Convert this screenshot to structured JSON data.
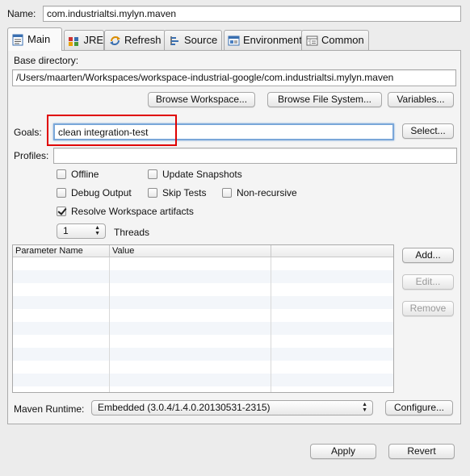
{
  "name": {
    "label": "Name:",
    "value": "com.industrialtsi.mylyn.maven"
  },
  "tabs": [
    {
      "label": "Main",
      "icon": "document-icon",
      "active": true
    },
    {
      "label": "JRE",
      "icon": "jre-icon",
      "active": false
    },
    {
      "label": "Refresh",
      "icon": "refresh-icon",
      "active": false
    },
    {
      "label": "Source",
      "icon": "source-icon",
      "active": false
    },
    {
      "label": "Environment",
      "icon": "environment-icon",
      "active": false
    },
    {
      "label": "Common",
      "icon": "common-icon",
      "active": false
    }
  ],
  "base_directory": {
    "label": "Base directory:",
    "value": "/Users/maarten/Workspaces/workspace-industrial-google/com.industrialtsi.mylyn.maven",
    "browse_workspace": "Browse Workspace...",
    "browse_file_system": "Browse File System...",
    "variables": "Variables..."
  },
  "goals": {
    "label": "Goals:",
    "value": "clean integration-test",
    "select_button": "Select..."
  },
  "profiles": {
    "label": "Profiles:",
    "value": ""
  },
  "options": {
    "offline": {
      "label": "Offline",
      "checked": false
    },
    "update_snapshots": {
      "label": "Update Snapshots",
      "checked": false
    },
    "debug_output": {
      "label": "Debug Output",
      "checked": false
    },
    "skip_tests": {
      "label": "Skip Tests",
      "checked": false
    },
    "non_recursive": {
      "label": "Non-recursive",
      "checked": false
    },
    "resolve_workspace": {
      "label": "Resolve Workspace artifacts",
      "checked": true
    }
  },
  "threads": {
    "value": "1",
    "label": "Threads"
  },
  "parameters": {
    "columns": [
      "Parameter Name",
      "Value"
    ],
    "rows": [],
    "add_button": "Add...",
    "edit_button": "Edit...",
    "remove_button": "Remove"
  },
  "maven_runtime": {
    "label": "Maven Runtime:",
    "value": "Embedded (3.0.4/1.4.0.20130531-2315)",
    "configure_button": "Configure..."
  },
  "footer": {
    "apply": "Apply",
    "revert": "Revert"
  },
  "colors": {
    "highlight": "#e00000",
    "background": "#ececec"
  }
}
